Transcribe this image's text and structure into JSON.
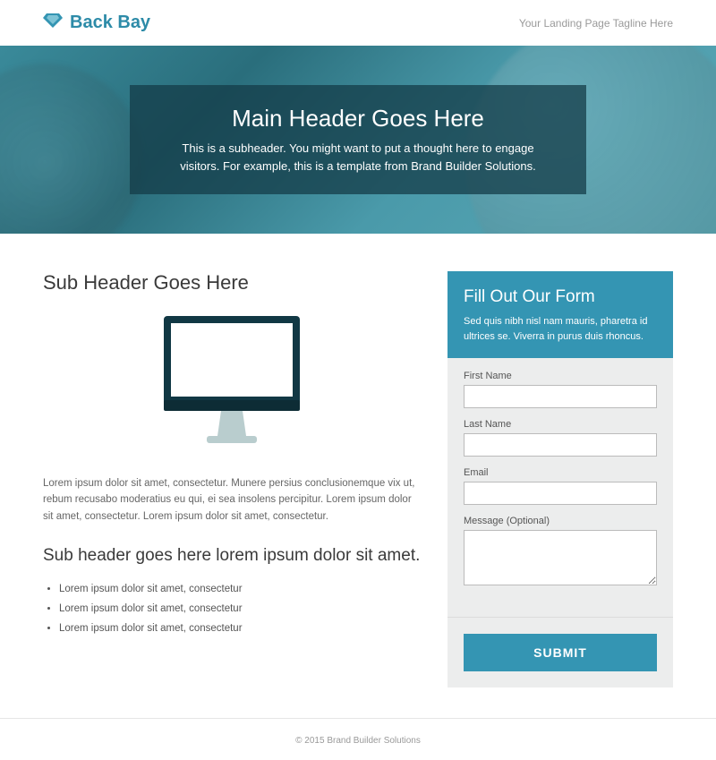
{
  "colors": {
    "accent": "#3495b3",
    "dark_accent": "#113844"
  },
  "header": {
    "brand": "Back Bay",
    "tagline": "Your Landing Page Tagline Here"
  },
  "hero": {
    "title": "Main Header Goes Here",
    "subheader": "This is a subheader. You might want to put a thought here to engage visitors. For example, this is a template from Brand Builder Solutions."
  },
  "content": {
    "sub_header": "Sub Header Goes Here",
    "paragraph": "Lorem ipsum dolor sit amet, consectetur. Munere persius conclusionemque vix ut, rebum recusabo moderatius eu qui, ei sea insolens percipitur. Lorem ipsum dolor sit amet, consectetur. Lorem ipsum dolor sit amet, consectetur.",
    "sub_header_2": "Sub header goes here lorem ipsum dolor sit amet.",
    "bullets": [
      "Lorem ipsum dolor sit amet, consectetur",
      "Lorem ipsum dolor sit amet, consectetur",
      "Lorem ipsum dolor sit amet, consectetur"
    ]
  },
  "form": {
    "title": "Fill Out Our Form",
    "subtitle": "Sed quis nibh nisl nam mauris, pharetra id ultrices se. Viverra in purus duis rhoncus.",
    "fields": {
      "first_name": {
        "label": "First Name",
        "value": ""
      },
      "last_name": {
        "label": "Last Name",
        "value": ""
      },
      "email": {
        "label": "Email",
        "value": ""
      },
      "message": {
        "label": "Message (Optional)",
        "value": ""
      }
    },
    "submit_label": "SUBMIT"
  },
  "footer": {
    "copyright": "© 2015 Brand Builder Solutions"
  }
}
